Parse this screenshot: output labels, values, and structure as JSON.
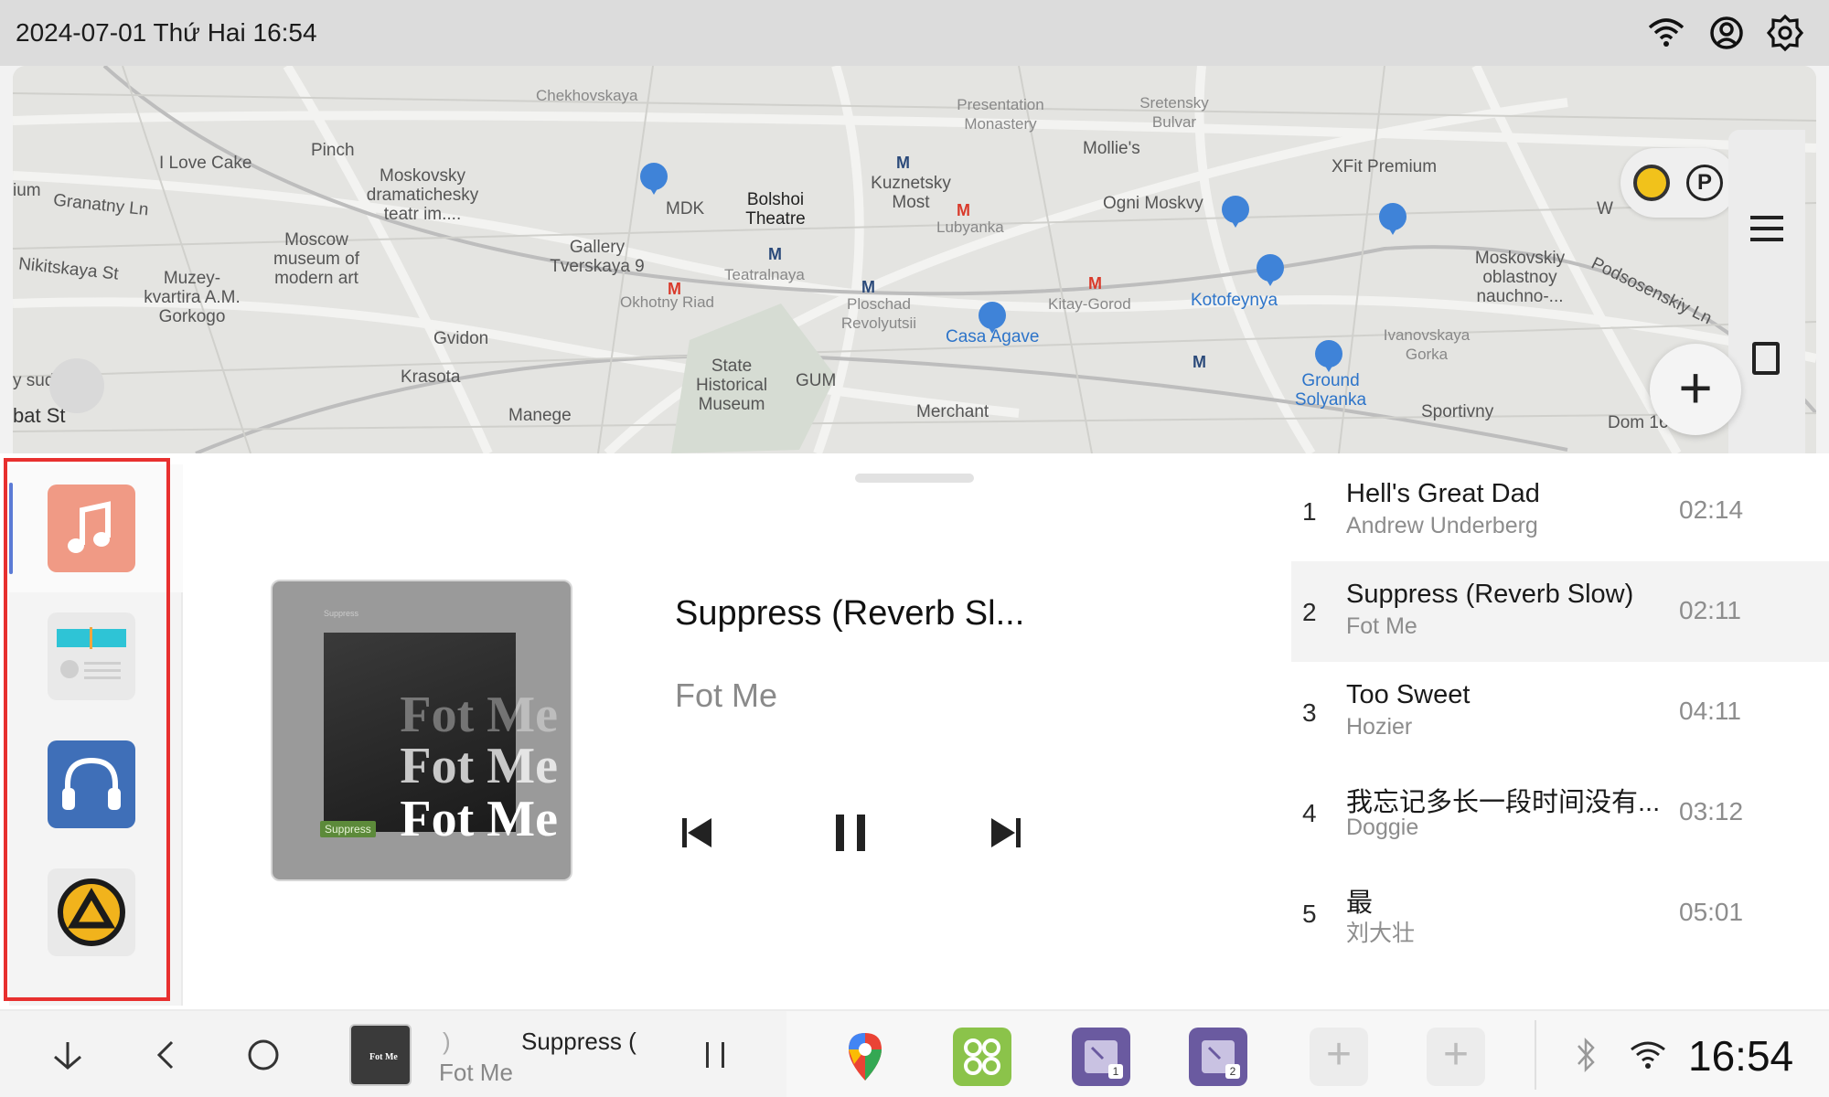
{
  "status_bar": {
    "datetime": "2024-07-01 Thứ Hai 16:54",
    "icons": [
      "wifi-icon",
      "account-icon",
      "settings-icon"
    ]
  },
  "map": {
    "labels": [
      "Chekhovskaya",
      "Presentation Monastery",
      "Sretensky Bulvar",
      "I Love Cake",
      "Pinch",
      "Moskovsky dramatichesky teatr im....",
      "MDK",
      "Bolshoi Theatre",
      "Kuznetsky Most",
      "Mollie's",
      "XFit Premium",
      "Granatny Ln",
      "Nikitskaya St",
      "Moscow museum of modern art",
      "Muzey-kvartira A.M. Gorkogo",
      "Gallery Tverskaya 9",
      "Teatralnaya",
      "Lubyanka",
      "Ogni Moskvy",
      "Okhotny Riad",
      "Ploschad Revolyutsii",
      "Kitay-Gorod",
      "Kotofeynya",
      "Moskovskiy oblastnoy nauchno-...",
      "Podsosenskiy Ln",
      "Gvidon",
      "Casa Agave",
      "Ivanovskaya Gorka",
      "Krasota",
      "State Historical Museum",
      "GUM",
      "Ground Solyanka",
      "Manege",
      "Merchant",
      "Sportivny",
      "ium",
      "y sud",
      "bat St",
      "W",
      "Dom 16"
    ]
  },
  "sources": [
    {
      "name": "music",
      "active": true
    },
    {
      "name": "radio",
      "active": false
    },
    {
      "name": "bluetooth-audio",
      "active": false
    },
    {
      "name": "aimp",
      "active": false
    }
  ],
  "now_playing": {
    "title": "Suppress (Reverb Sl...",
    "artist": "Fot Me",
    "art_text": [
      "Fot Me",
      "Fot Me",
      "Fot Me"
    ],
    "art_label": "Suppress",
    "art_small": "Suppress"
  },
  "tracks": [
    {
      "num": "1",
      "title": "Hell's Great Dad",
      "artist": "Andrew Underberg",
      "duration": "02:14",
      "playing": false
    },
    {
      "num": "2",
      "title": "Suppress (Reverb Slow)",
      "artist": "Fot Me",
      "duration": "02:11",
      "playing": true
    },
    {
      "num": "3",
      "title": "Too Sweet",
      "artist": "Hozier",
      "duration": "04:11",
      "playing": false
    },
    {
      "num": "4",
      "title": "我忘记多长一段时间没有...",
      "artist": "Doggie",
      "duration": "03:12",
      "playing": false
    },
    {
      "num": "5",
      "title": "最",
      "artist": "刘大壮",
      "duration": "05:01",
      "playing": false
    }
  ],
  "navbar": {
    "mini_title": "Suppress (",
    "mini_fragment": ")",
    "mini_artist": "Fot Me",
    "mini_art_text": "Fot Me",
    "dock_badges": [
      "1",
      "2"
    ],
    "clock": "16:54"
  },
  "colors": {
    "accent": "#5b7bd6",
    "highlight_box": "#e8302f",
    "music_tile": "#f09a85",
    "bluetooth_tile": "#3f6fb8",
    "aimp_yellow": "#f1b31c",
    "dock_green": "#8bc34a",
    "dock_purple": "#6a5aa0"
  }
}
